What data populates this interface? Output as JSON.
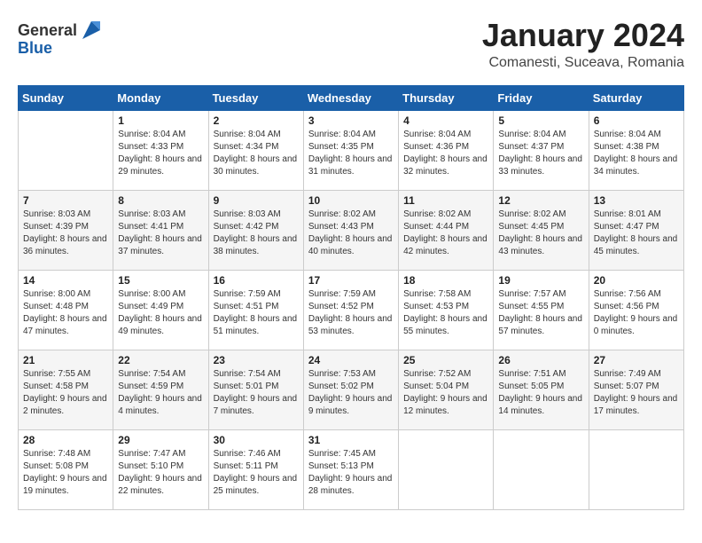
{
  "header": {
    "logo_general": "General",
    "logo_blue": "Blue",
    "title": "January 2024",
    "subtitle": "Comanesti, Suceava, Romania"
  },
  "days_of_week": [
    "Sunday",
    "Monday",
    "Tuesday",
    "Wednesday",
    "Thursday",
    "Friday",
    "Saturday"
  ],
  "weeks": [
    [
      {
        "day": "",
        "sunrise": "",
        "sunset": "",
        "daylight": "",
        "shaded": false
      },
      {
        "day": "1",
        "sunrise": "Sunrise: 8:04 AM",
        "sunset": "Sunset: 4:33 PM",
        "daylight": "Daylight: 8 hours and 29 minutes.",
        "shaded": false
      },
      {
        "day": "2",
        "sunrise": "Sunrise: 8:04 AM",
        "sunset": "Sunset: 4:34 PM",
        "daylight": "Daylight: 8 hours and 30 minutes.",
        "shaded": false
      },
      {
        "day": "3",
        "sunrise": "Sunrise: 8:04 AM",
        "sunset": "Sunset: 4:35 PM",
        "daylight": "Daylight: 8 hours and 31 minutes.",
        "shaded": false
      },
      {
        "day": "4",
        "sunrise": "Sunrise: 8:04 AM",
        "sunset": "Sunset: 4:36 PM",
        "daylight": "Daylight: 8 hours and 32 minutes.",
        "shaded": false
      },
      {
        "day": "5",
        "sunrise": "Sunrise: 8:04 AM",
        "sunset": "Sunset: 4:37 PM",
        "daylight": "Daylight: 8 hours and 33 minutes.",
        "shaded": false
      },
      {
        "day": "6",
        "sunrise": "Sunrise: 8:04 AM",
        "sunset": "Sunset: 4:38 PM",
        "daylight": "Daylight: 8 hours and 34 minutes.",
        "shaded": false
      }
    ],
    [
      {
        "day": "7",
        "sunrise": "Sunrise: 8:03 AM",
        "sunset": "Sunset: 4:39 PM",
        "daylight": "Daylight: 8 hours and 36 minutes.",
        "shaded": true
      },
      {
        "day": "8",
        "sunrise": "Sunrise: 8:03 AM",
        "sunset": "Sunset: 4:41 PM",
        "daylight": "Daylight: 8 hours and 37 minutes.",
        "shaded": true
      },
      {
        "day": "9",
        "sunrise": "Sunrise: 8:03 AM",
        "sunset": "Sunset: 4:42 PM",
        "daylight": "Daylight: 8 hours and 38 minutes.",
        "shaded": true
      },
      {
        "day": "10",
        "sunrise": "Sunrise: 8:02 AM",
        "sunset": "Sunset: 4:43 PM",
        "daylight": "Daylight: 8 hours and 40 minutes.",
        "shaded": true
      },
      {
        "day": "11",
        "sunrise": "Sunrise: 8:02 AM",
        "sunset": "Sunset: 4:44 PM",
        "daylight": "Daylight: 8 hours and 42 minutes.",
        "shaded": true
      },
      {
        "day": "12",
        "sunrise": "Sunrise: 8:02 AM",
        "sunset": "Sunset: 4:45 PM",
        "daylight": "Daylight: 8 hours and 43 minutes.",
        "shaded": true
      },
      {
        "day": "13",
        "sunrise": "Sunrise: 8:01 AM",
        "sunset": "Sunset: 4:47 PM",
        "daylight": "Daylight: 8 hours and 45 minutes.",
        "shaded": true
      }
    ],
    [
      {
        "day": "14",
        "sunrise": "Sunrise: 8:00 AM",
        "sunset": "Sunset: 4:48 PM",
        "daylight": "Daylight: 8 hours and 47 minutes.",
        "shaded": false
      },
      {
        "day": "15",
        "sunrise": "Sunrise: 8:00 AM",
        "sunset": "Sunset: 4:49 PM",
        "daylight": "Daylight: 8 hours and 49 minutes.",
        "shaded": false
      },
      {
        "day": "16",
        "sunrise": "Sunrise: 7:59 AM",
        "sunset": "Sunset: 4:51 PM",
        "daylight": "Daylight: 8 hours and 51 minutes.",
        "shaded": false
      },
      {
        "day": "17",
        "sunrise": "Sunrise: 7:59 AM",
        "sunset": "Sunset: 4:52 PM",
        "daylight": "Daylight: 8 hours and 53 minutes.",
        "shaded": false
      },
      {
        "day": "18",
        "sunrise": "Sunrise: 7:58 AM",
        "sunset": "Sunset: 4:53 PM",
        "daylight": "Daylight: 8 hours and 55 minutes.",
        "shaded": false
      },
      {
        "day": "19",
        "sunrise": "Sunrise: 7:57 AM",
        "sunset": "Sunset: 4:55 PM",
        "daylight": "Daylight: 8 hours and 57 minutes.",
        "shaded": false
      },
      {
        "day": "20",
        "sunrise": "Sunrise: 7:56 AM",
        "sunset": "Sunset: 4:56 PM",
        "daylight": "Daylight: 9 hours and 0 minutes.",
        "shaded": false
      }
    ],
    [
      {
        "day": "21",
        "sunrise": "Sunrise: 7:55 AM",
        "sunset": "Sunset: 4:58 PM",
        "daylight": "Daylight: 9 hours and 2 minutes.",
        "shaded": true
      },
      {
        "day": "22",
        "sunrise": "Sunrise: 7:54 AM",
        "sunset": "Sunset: 4:59 PM",
        "daylight": "Daylight: 9 hours and 4 minutes.",
        "shaded": true
      },
      {
        "day": "23",
        "sunrise": "Sunrise: 7:54 AM",
        "sunset": "Sunset: 5:01 PM",
        "daylight": "Daylight: 9 hours and 7 minutes.",
        "shaded": true
      },
      {
        "day": "24",
        "sunrise": "Sunrise: 7:53 AM",
        "sunset": "Sunset: 5:02 PM",
        "daylight": "Daylight: 9 hours and 9 minutes.",
        "shaded": true
      },
      {
        "day": "25",
        "sunrise": "Sunrise: 7:52 AM",
        "sunset": "Sunset: 5:04 PM",
        "daylight": "Daylight: 9 hours and 12 minutes.",
        "shaded": true
      },
      {
        "day": "26",
        "sunrise": "Sunrise: 7:51 AM",
        "sunset": "Sunset: 5:05 PM",
        "daylight": "Daylight: 9 hours and 14 minutes.",
        "shaded": true
      },
      {
        "day": "27",
        "sunrise": "Sunrise: 7:49 AM",
        "sunset": "Sunset: 5:07 PM",
        "daylight": "Daylight: 9 hours and 17 minutes.",
        "shaded": true
      }
    ],
    [
      {
        "day": "28",
        "sunrise": "Sunrise: 7:48 AM",
        "sunset": "Sunset: 5:08 PM",
        "daylight": "Daylight: 9 hours and 19 minutes.",
        "shaded": false
      },
      {
        "day": "29",
        "sunrise": "Sunrise: 7:47 AM",
        "sunset": "Sunset: 5:10 PM",
        "daylight": "Daylight: 9 hours and 22 minutes.",
        "shaded": false
      },
      {
        "day": "30",
        "sunrise": "Sunrise: 7:46 AM",
        "sunset": "Sunset: 5:11 PM",
        "daylight": "Daylight: 9 hours and 25 minutes.",
        "shaded": false
      },
      {
        "day": "31",
        "sunrise": "Sunrise: 7:45 AM",
        "sunset": "Sunset: 5:13 PM",
        "daylight": "Daylight: 9 hours and 28 minutes.",
        "shaded": false
      },
      {
        "day": "",
        "sunrise": "",
        "sunset": "",
        "daylight": "",
        "shaded": false
      },
      {
        "day": "",
        "sunrise": "",
        "sunset": "",
        "daylight": "",
        "shaded": false
      },
      {
        "day": "",
        "sunrise": "",
        "sunset": "",
        "daylight": "",
        "shaded": false
      }
    ]
  ]
}
